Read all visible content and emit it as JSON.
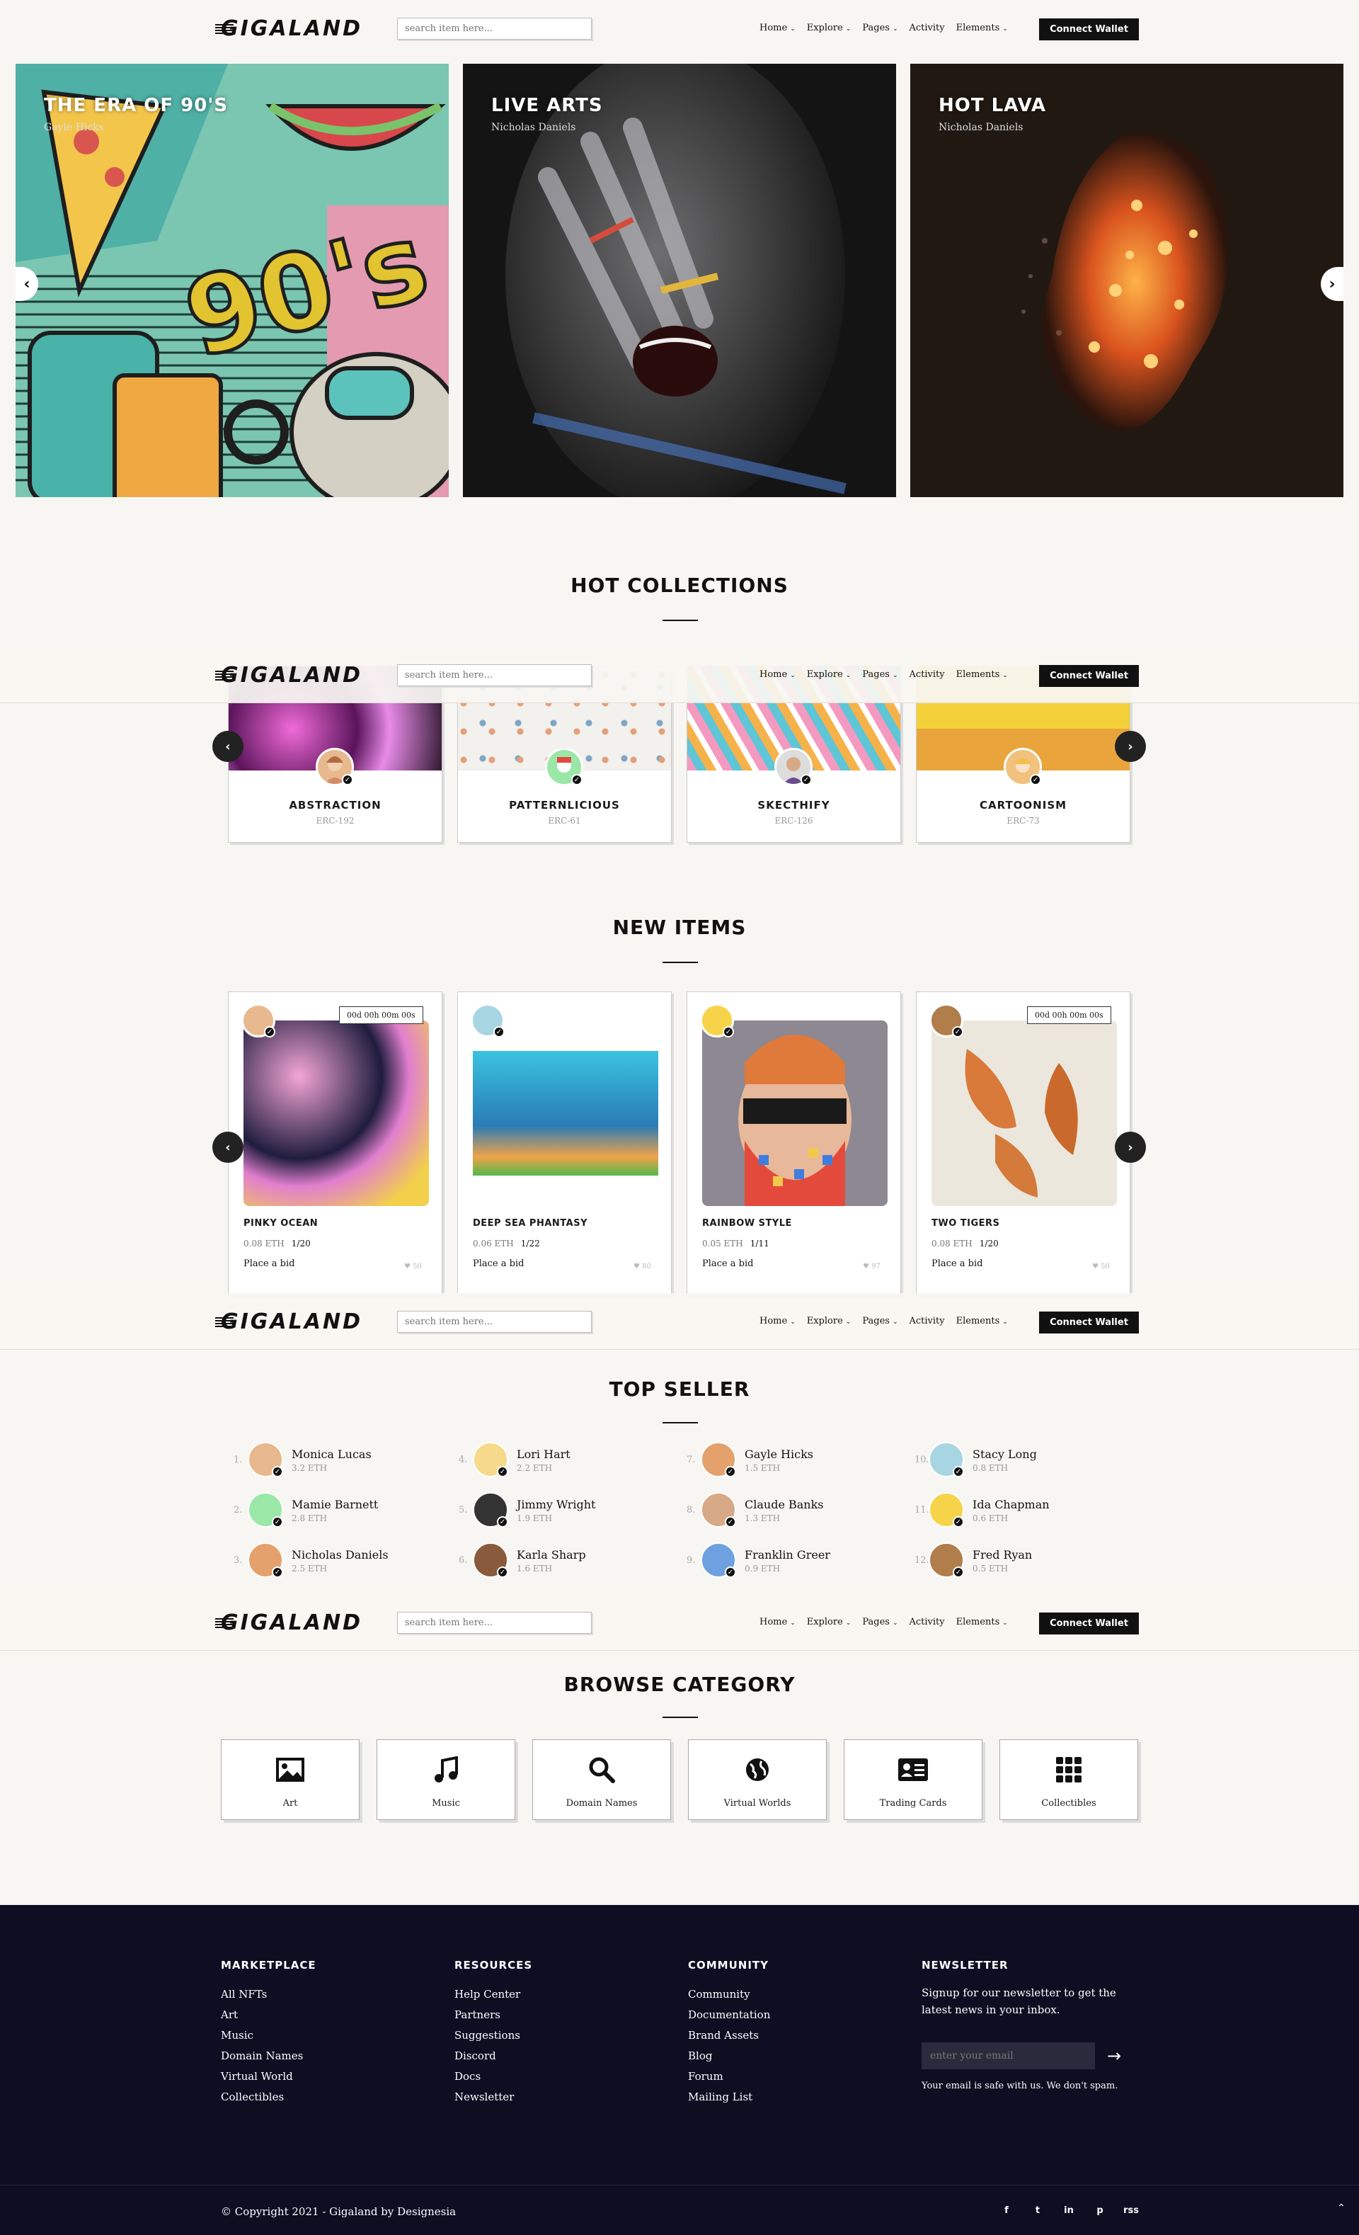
{
  "nav": {
    "logo": "GIGALAND",
    "search_placeholder": "search item here...",
    "menu": {
      "home": "Home",
      "explore": "Explore",
      "pages": "Pages",
      "activity": "Activity",
      "elements": "Elements"
    },
    "wallet": "Connect Wallet"
  },
  "hero": [
    {
      "title": "THE ERA OF 90'S",
      "author": "Gayle Hicks"
    },
    {
      "title": "LIVE ARTS",
      "author": "Nicholas Daniels"
    },
    {
      "title": "HOT LAVA",
      "author": "Nicholas Daniels"
    }
  ],
  "hero_decor": "90's",
  "hot_collections": {
    "title": "HOT COLLECTIONS",
    "items": [
      {
        "name": "ABSTRACTION",
        "sub": "ERC-192"
      },
      {
        "name": "PATTERNLICIOUS",
        "sub": "ERC-61"
      },
      {
        "name": "SKECTHIFY",
        "sub": "ERC-126"
      },
      {
        "name": "CARTOONISM",
        "sub": "ERC-73"
      }
    ]
  },
  "new_items": {
    "title": "NEW ITEMS",
    "items": [
      {
        "name": "PINKY OCEAN",
        "price": "0.08 ETH",
        "qty": "1/20",
        "bid": "Place a bid",
        "likes": "50",
        "timer": "00d 00h 00m 00s"
      },
      {
        "name": "DEEP SEA PHANTASY",
        "price": "0.06 ETH",
        "qty": "1/22",
        "bid": "Place a bid",
        "likes": "80"
      },
      {
        "name": "RAINBOW STYLE",
        "price": "0.05 ETH",
        "qty": "1/11",
        "bid": "Place a bid",
        "likes": "97"
      },
      {
        "name": "TWO TIGERS",
        "price": "0.08 ETH",
        "qty": "1/20",
        "bid": "Place a bid",
        "likes": "50",
        "timer": "00d 00h 00m 00s"
      }
    ]
  },
  "top_seller": {
    "title": "TOP SELLER",
    "sellers": [
      {
        "num": "1.",
        "name": "Monica Lucas",
        "eth": "3.2 ETH"
      },
      {
        "num": "2.",
        "name": "Mamie Barnett",
        "eth": "2.8 ETH"
      },
      {
        "num": "3.",
        "name": "Nicholas Daniels",
        "eth": "2.5 ETH"
      },
      {
        "num": "4.",
        "name": "Lori Hart",
        "eth": "2.2 ETH"
      },
      {
        "num": "5.",
        "name": "Jimmy Wright",
        "eth": "1.9 ETH"
      },
      {
        "num": "6.",
        "name": "Karla Sharp",
        "eth": "1.6 ETH"
      },
      {
        "num": "7.",
        "name": "Gayle Hicks",
        "eth": "1.5 ETH"
      },
      {
        "num": "8.",
        "name": "Claude Banks",
        "eth": "1.3 ETH"
      },
      {
        "num": "9.",
        "name": "Franklin Greer",
        "eth": "0.9 ETH"
      },
      {
        "num": "10.",
        "name": "Stacy Long",
        "eth": "0.8 ETH"
      },
      {
        "num": "11.",
        "name": "Ida Chapman",
        "eth": "0.6 ETH"
      },
      {
        "num": "12.",
        "name": "Fred Ryan",
        "eth": "0.5 ETH"
      }
    ]
  },
  "browse": {
    "title": "BROWSE CATEGORY",
    "categories": [
      {
        "label": "Art",
        "icon": "image-icon"
      },
      {
        "label": "Music",
        "icon": "music-icon"
      },
      {
        "label": "Domain Names",
        "icon": "search-icon"
      },
      {
        "label": "Virtual Worlds",
        "icon": "globe-icon"
      },
      {
        "label": "Trading Cards",
        "icon": "card-icon"
      },
      {
        "label": "Collectibles",
        "icon": "grid-icon"
      }
    ]
  },
  "footer": {
    "marketplace": {
      "title": "MARKETPLACE",
      "links": [
        "All NFTs",
        "Art",
        "Music",
        "Domain Names",
        "Virtual World",
        "Collectibles"
      ]
    },
    "resources": {
      "title": "RESOURCES",
      "links": [
        "Help Center",
        "Partners",
        "Suggestions",
        "Discord",
        "Docs",
        "Newsletter"
      ]
    },
    "community": {
      "title": "COMMUNITY",
      "links": [
        "Community",
        "Documentation",
        "Brand Assets",
        "Blog",
        "Forum",
        "Mailing List"
      ]
    },
    "newsletter": {
      "title": "NEWSLETTER",
      "text": "Signup for our newsletter to get the latest news in your inbox.",
      "placeholder": "enter your email",
      "note": "Your email is safe with us. We don't spam."
    },
    "copyright": "© Copyright 2021 - Gigaland by Designesia",
    "social": [
      "f",
      "t",
      "in",
      "p",
      "rss"
    ]
  },
  "colors": {
    "background": "#f8f6f2",
    "dark": "#111111",
    "footer": "#0e0d22"
  }
}
